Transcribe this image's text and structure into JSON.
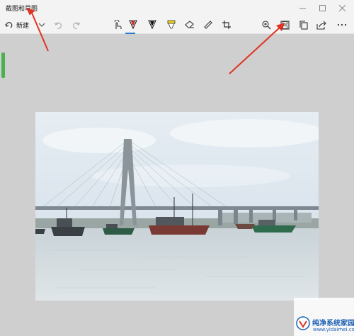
{
  "app": {
    "title": "截图和草图"
  },
  "toolbar": {
    "new_label": "新建",
    "colors": {
      "pen": "#d2281e",
      "pencil": "#111111",
      "highlighter": "#f2d41c",
      "active_underline": "#2b7bd6",
      "annotation_arrow": "#e03323"
    },
    "icons": [
      "new-snip-icon",
      "chevron-down-icon",
      "undo-icon",
      "redo-icon",
      "touch-writing-icon",
      "ballpoint-pen-icon",
      "pencil-icon",
      "highlighter-icon",
      "eraser-icon",
      "ruler-icon",
      "crop-icon",
      "zoom-icon",
      "save-icon",
      "copy-icon",
      "share-icon",
      "more-icon"
    ]
  },
  "watermark": {
    "title": "纯净系统家园",
    "url": "www.yidaimei.com"
  }
}
